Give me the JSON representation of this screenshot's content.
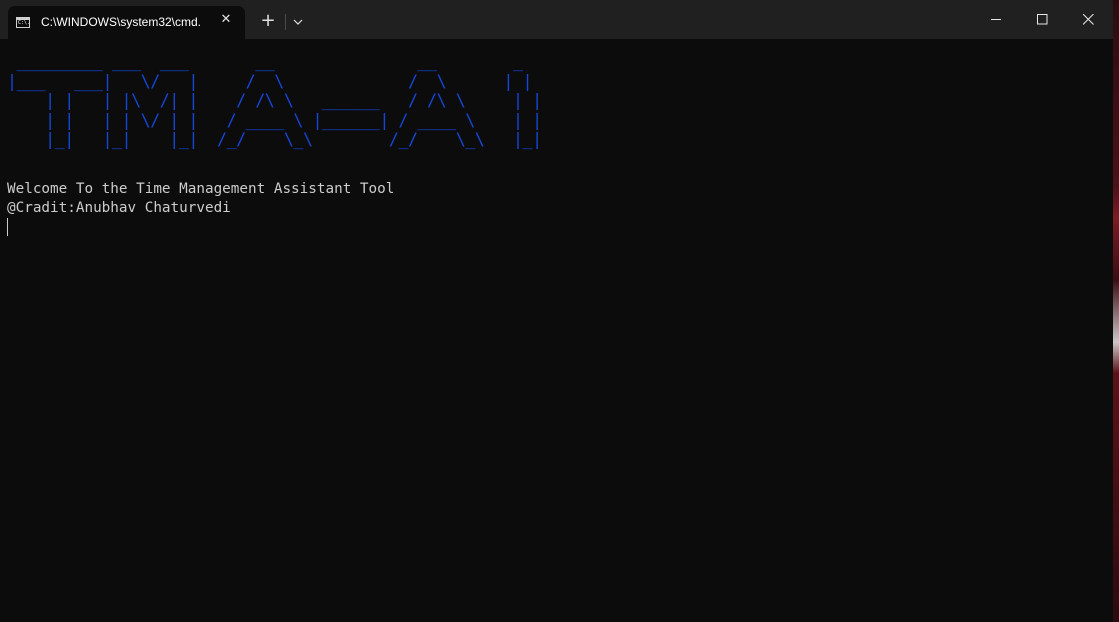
{
  "window": {
    "tab_title": "C:\\WINDOWS\\system32\\cmd.",
    "tab_icon": "cmd-icon",
    "tab_icon_text": "C:\\.",
    "close_tab_symbol": "✕",
    "new_tab_symbol": "+",
    "controls": {
      "minimize": "minimize-icon",
      "maximize": "maximize-icon",
      "close": "close-icon"
    }
  },
  "terminal": {
    "banner": " _________ ___  ___       __               __        _\n|___   ___|   \\/   |     /  \\             /  \\      | |\n    | |   | |\\  /| |    / /\\ \\   ______   / /\\ \\     | |\n    | |   | | \\/ | |   / ____ \\ |______| / ____ \\    | |\n    |_|   |_|    |_|  /_/    \\_\\        /_/    \\_\\   |_|",
    "banner_color": "#1546d6",
    "welcome_line": "Welcome To the Time Management Assistant Tool",
    "credit_line": "@Cradit:Anubhav Chaturvedi",
    "text_color": "#cccccc",
    "background": "#0c0c0c"
  }
}
